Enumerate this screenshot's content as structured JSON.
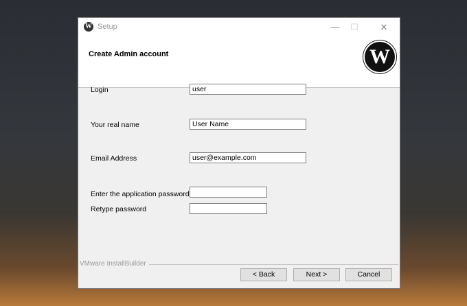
{
  "window": {
    "title": "Setup",
    "minimize": "—",
    "maximize": "☐",
    "close": "✕"
  },
  "header": {
    "title": "Create Admin account",
    "logo": "W"
  },
  "form": {
    "login_label": "Login",
    "login_value": "user",
    "name_label": "Your real name",
    "name_value": "User Name",
    "email_label": "Email Address",
    "email_value": "user@example.com",
    "password_label": "Enter the application password",
    "password_value": "",
    "retype_label": "Retype password",
    "retype_value": ""
  },
  "footer": {
    "brand": "VMware InstallBuilder",
    "back": "< Back",
    "next": "Next >",
    "cancel": "Cancel"
  }
}
